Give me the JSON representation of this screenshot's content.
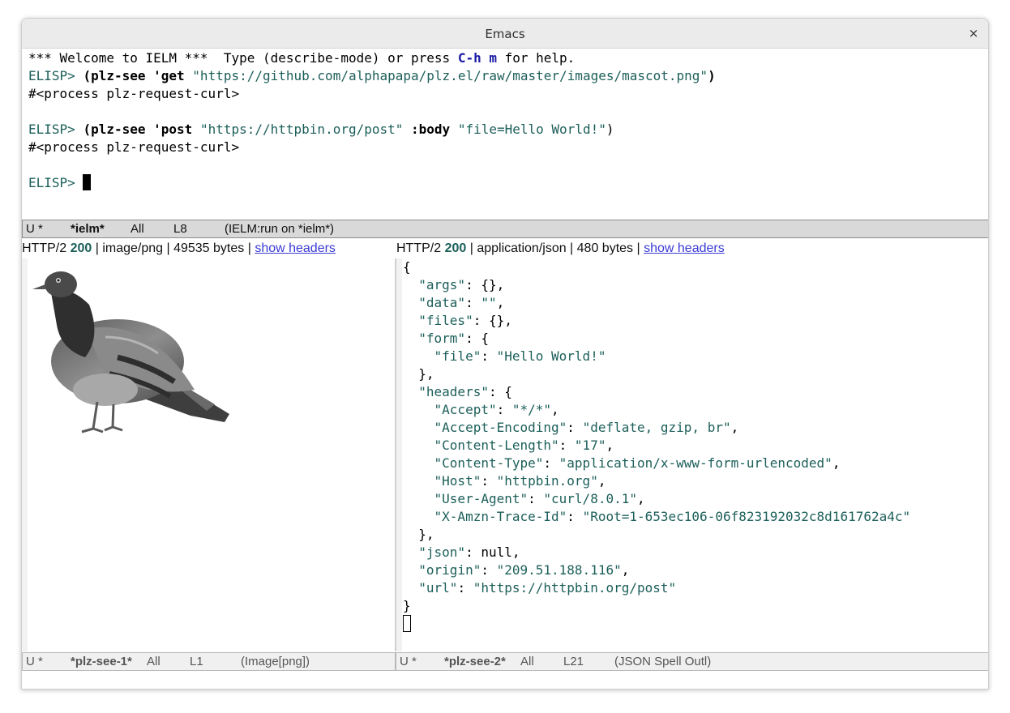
{
  "window": {
    "title": "Emacs",
    "close_glyph": "×"
  },
  "ielm": {
    "welcome": {
      "pre": "*** Welcome to IELM ***  Type (describe-mode) or press ",
      "key": "C-h m",
      "post": " for help."
    },
    "prompt": "ELISP> ",
    "cmd1": {
      "open": "(plz-see 'get ",
      "url": "\"https://github.com/alphapapa/plz.el/raw/master/images/mascot.png\"",
      "close": ")"
    },
    "result1": "#<process plz-request-curl>",
    "cmd2": {
      "open": "(plz-see 'post ",
      "url": "\"https://httpbin.org/post\"",
      "kw": " :body ",
      "body": "\"file=Hello World!\"",
      "close": ")"
    },
    "result2": "#<process plz-request-curl>"
  },
  "modeline_top": {
    "flags": "U *",
    "buffer": "*ielm*",
    "pos": "All",
    "line": "L8",
    "mode": "(IELM:run on *ielm*)"
  },
  "left_header": {
    "proto": "HTTP/2 ",
    "status": "200",
    "info": " | image/png | 49535 bytes | ",
    "link": "show headers"
  },
  "right_header": {
    "proto": "HTTP/2 ",
    "status": "200",
    "info": " | application/json | 480 bytes | ",
    "link": "show headers"
  },
  "json": {
    "args": {
      "key": "\"args\"",
      "val": "{},"
    },
    "data": {
      "key": "\"data\"",
      "val": "\"\""
    },
    "files": {
      "key": "\"files\"",
      "val": "{},"
    },
    "form": {
      "key": "\"form\"",
      "file_key": "\"file\"",
      "file_val": "\"Hello World!\""
    },
    "headers_key": "\"headers\"",
    "headers": [
      {
        "k": "\"Accept\"",
        "v": "\"*/*\""
      },
      {
        "k": "\"Accept-Encoding\"",
        "v": "\"deflate, gzip, br\""
      },
      {
        "k": "\"Content-Length\"",
        "v": "\"17\""
      },
      {
        "k": "\"Content-Type\"",
        "v": "\"application/x-www-form-urlencoded\""
      },
      {
        "k": "\"Host\"",
        "v": "\"httpbin.org\""
      },
      {
        "k": "\"User-Agent\"",
        "v": "\"curl/8.0.1\""
      },
      {
        "k": "\"X-Amzn-Trace-Id\"",
        "v": "\"Root=1-653ec106-06f823192032c8d161762a4c\""
      }
    ],
    "json_key": "\"json\"",
    "json_val": "null",
    "origin_key": "\"origin\"",
    "origin_val": "\"209.51.188.116\"",
    "url_key": "\"url\"",
    "url_val": "\"https://httpbin.org/post\""
  },
  "modeline_left": {
    "flags": "U *",
    "buffer": "*plz-see-1*",
    "pos": "All",
    "line": "L1",
    "mode": "(Image[png])"
  },
  "modeline_right": {
    "flags": "U *",
    "buffer": "*plz-see-2*",
    "pos": "All",
    "line": "L21",
    "mode": "(JSON Spell Outl)"
  },
  "image": {
    "icon": "pigeon-image"
  }
}
